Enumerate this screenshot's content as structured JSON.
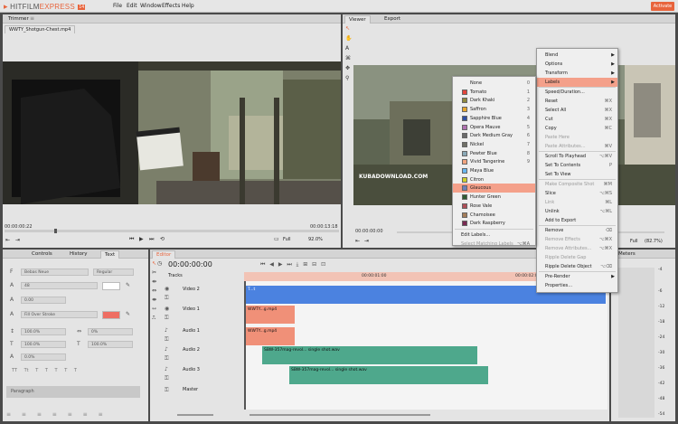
{
  "app": {
    "logo_main": "HITFILM",
    "logo_express": "EXPRESS",
    "logo_badge": "14",
    "menu": [
      "File",
      "Edit",
      "Window",
      "Effects",
      "Help"
    ],
    "activate": "Activate"
  },
  "trimmer": {
    "tab": "Trimmer",
    "file_tab": "WWTY_Shotgun-Chest.mp4",
    "time_left": "00:00:00:22",
    "time_right": "00:00:13:18",
    "zoom": "Full",
    "zoom_pct": "92.0%"
  },
  "viewer": {
    "tabs": [
      "Viewer",
      "Export"
    ],
    "watermark": "KUBADOWNLOAD.COM",
    "time_left": "00:00:00:00",
    "zoom": "Full",
    "zoom_pct": "(82.7%)"
  },
  "left_panel": {
    "tabs": [
      "Controls",
      "History",
      "Text"
    ],
    "font": "Bebas Neue",
    "style": "Regular",
    "size": "48",
    "tracking": "0.00",
    "stroke": "Fill Over Stroke",
    "v1": "100.0%",
    "v2": "0%",
    "v3": "100.0%",
    "v4": "100.0%",
    "v5": "0.0%",
    "paragraph": "Paragraph",
    "text_style_glyphs": [
      "TT",
      "Tt",
      "T",
      "T",
      "T",
      "T",
      "T"
    ]
  },
  "editor": {
    "tab": "Editor",
    "timecode": "00:00:00:00",
    "tracks_label": "Tracks",
    "ruler": [
      "00:00:01:00",
      "00:00:02:00"
    ],
    "tracks": [
      {
        "name": "Video 2",
        "clip": "T...t"
      },
      {
        "name": "Video 1",
        "clip": "WWTY...g.mp4"
      },
      {
        "name": "Audio 1",
        "clip": "WWTY...g.mp4"
      },
      {
        "name": "Audio 2",
        "clip": "SBW-357mag-revol... single shot.wav"
      },
      {
        "name": "Audio 3",
        "clip": "SBW-357mag-revol... single shot.wav"
      },
      {
        "name": "Master",
        "clip": ""
      }
    ]
  },
  "meters": {
    "tab": "Meters",
    "scale": [
      "-6",
      "-12",
      "-18",
      "-24",
      "-30",
      "-36",
      "-42",
      "-48",
      "-54"
    ],
    "top": "-4"
  },
  "context_menu": {
    "items": [
      {
        "label": "Blend",
        "sc": "",
        "arrow": true,
        "dis": false
      },
      {
        "label": "Options",
        "sc": "",
        "arrow": true,
        "dis": false
      },
      {
        "label": "Transform",
        "sc": "",
        "arrow": true,
        "dis": false
      },
      {
        "label": "Labels",
        "sc": "",
        "arrow": true,
        "dis": false,
        "hl": true
      },
      {
        "label": "Speed/Duration...",
        "sc": "",
        "arrow": false,
        "dis": false
      },
      {
        "label": "Reset",
        "sc": "⌘X",
        "arrow": false,
        "dis": false
      },
      {
        "label": "Select All",
        "sc": "⌘X",
        "arrow": false,
        "dis": false
      },
      {
        "label": "Cut",
        "sc": "⌘X",
        "arrow": false,
        "dis": false
      },
      {
        "label": "Copy",
        "sc": "⌘C",
        "arrow": false,
        "dis": false
      },
      {
        "label": "Paste Here",
        "sc": "",
        "arrow": false,
        "dis": true
      },
      {
        "label": "Paste Attributes...",
        "sc": "⌘V",
        "arrow": false,
        "dis": true
      },
      {
        "label": "Scroll To Playhead",
        "sc": "⌥⌘V",
        "arrow": false,
        "dis": false
      },
      {
        "label": "Set To Contents",
        "sc": "P",
        "arrow": false,
        "dis": false
      },
      {
        "label": "Set To View",
        "sc": "",
        "arrow": false,
        "dis": false
      },
      {
        "label": "Make Composite Shot",
        "sc": "⌘M",
        "arrow": false,
        "dis": true
      },
      {
        "label": "Slice",
        "sc": "⌥⌘S",
        "arrow": false,
        "dis": false
      },
      {
        "label": "Link",
        "sc": "⌘L",
        "arrow": false,
        "dis": true
      },
      {
        "label": "Unlink",
        "sc": "⌥⌘L",
        "arrow": false,
        "dis": false
      },
      {
        "label": "Add to Export",
        "sc": "",
        "arrow": false,
        "dis": false
      },
      {
        "label": "Remove",
        "sc": "⌫",
        "arrow": false,
        "dis": false
      },
      {
        "label": "Remove Effects",
        "sc": "⌥⌘X",
        "arrow": false,
        "dis": true
      },
      {
        "label": "Remove Attributes...",
        "sc": "⌥⌘X",
        "arrow": false,
        "dis": true
      },
      {
        "label": "Ripple Delete Gap",
        "sc": "",
        "arrow": false,
        "dis": true
      },
      {
        "label": "Ripple Delete Object",
        "sc": "⌥⌫",
        "arrow": false,
        "dis": false
      },
      {
        "label": "Pre-Render",
        "sc": "",
        "arrow": true,
        "dis": false
      },
      {
        "label": "Properties...",
        "sc": "",
        "arrow": false,
        "dis": false
      }
    ]
  },
  "labels_menu": {
    "items": [
      {
        "label": "None",
        "num": "0",
        "color": ""
      },
      {
        "label": "Tomato",
        "num": "1",
        "color": "#e2453c"
      },
      {
        "label": "Dark Khaki",
        "num": "2",
        "color": "#8f8a3f"
      },
      {
        "label": "Saffron",
        "num": "3",
        "color": "#e8a72d"
      },
      {
        "label": "Sapphire Blue",
        "num": "4",
        "color": "#2f4fa2"
      },
      {
        "label": "Opera Mauve",
        "num": "5",
        "color": "#b06fb0"
      },
      {
        "label": "Dark Medium Gray",
        "num": "6",
        "color": "#6a6a6a"
      },
      {
        "label": "Nickel",
        "num": "7",
        "color": "#6f6f66"
      },
      {
        "label": "Pewter Blue",
        "num": "8",
        "color": "#8aa9b7"
      },
      {
        "label": "Vivid Tangerine",
        "num": "9",
        "color": "#f2a47f"
      },
      {
        "label": "Maya Blue",
        "num": "",
        "color": "#68b7f0"
      },
      {
        "label": "Citron",
        "num": "",
        "color": "#cfd02b"
      },
      {
        "label": "Glaucous",
        "num": "",
        "color": "#6c7fba",
        "hl": true
      },
      {
        "label": "Hunter Green",
        "num": "",
        "color": "#2f5a31"
      },
      {
        "label": "Rose Vale",
        "num": "",
        "color": "#b04e57"
      },
      {
        "label": "Chamoisee",
        "num": "",
        "color": "#a57d5a"
      },
      {
        "label": "Dark Raspberry",
        "num": "",
        "color": "#7a2a53"
      }
    ],
    "edit": "Edit Labels...",
    "select": "Select Matching Labels",
    "select_sc": "⌥⌘A"
  }
}
